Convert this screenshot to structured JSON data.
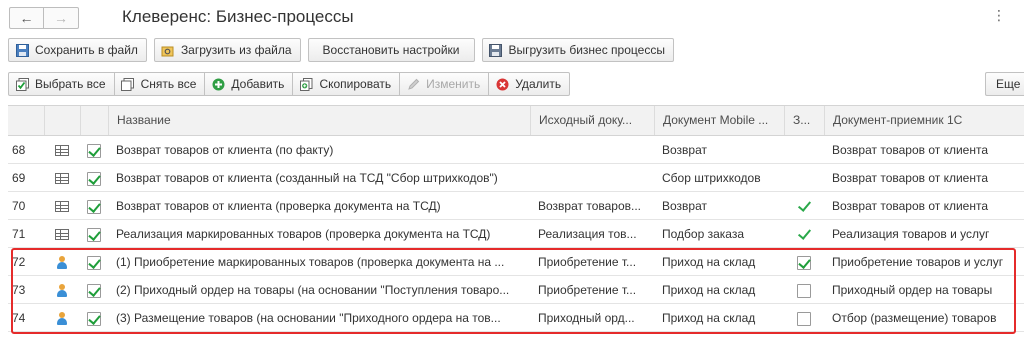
{
  "window": {
    "title": "Клеверенс: Бизнес-процессы"
  },
  "nav": {
    "back": "←",
    "forward": "→",
    "more": "⋮"
  },
  "toolbar1": [
    {
      "label": "Сохранить в файл",
      "icon": "save-icon"
    },
    {
      "label": "Загрузить из файла",
      "icon": "load-icon"
    },
    {
      "label": "Восстановить настройки",
      "icon": ""
    },
    {
      "label": "Выгрузить бизнес процессы",
      "icon": "export-icon"
    }
  ],
  "toolbar2": [
    {
      "label": "Выбрать все",
      "icon": "select-all-icon",
      "disabled": false
    },
    {
      "label": "Снять все",
      "icon": "clear-all-icon",
      "disabled": false
    },
    {
      "label": "Добавить",
      "icon": "add-icon",
      "disabled": false
    },
    {
      "label": "Скопировать",
      "icon": "copy-icon",
      "disabled": false
    },
    {
      "label": "Изменить",
      "icon": "edit-icon",
      "disabled": true
    },
    {
      "label": "Удалить",
      "icon": "delete-icon",
      "disabled": false
    }
  ],
  "more_label": "Еще",
  "columns": {
    "name": "Название",
    "source": "Исходный доку...",
    "mobile": "Документ Mobile ...",
    "z": "З...",
    "dest": "Документ-приемник 1С"
  },
  "rows": [
    {
      "num": "68",
      "type": "table",
      "checked": true,
      "name": "Возврат товаров от клиента (по факту)",
      "source": "",
      "mobile": "Возврат",
      "z": "",
      "dest": "Возврат товаров от клиента"
    },
    {
      "num": "69",
      "type": "table",
      "checked": true,
      "name": "Возврат товаров от клиента (созданный на ТСД \"Сбор штрихкодов\")",
      "source": "",
      "mobile": "Сбор штрихкодов",
      "z": "",
      "dest": "Возврат товаров от клиента"
    },
    {
      "num": "70",
      "type": "table",
      "checked": true,
      "name": "Возврат товаров от клиента (проверка документа на ТСД)",
      "source": "Возврат товаров...",
      "mobile": "Возврат",
      "z": "tick",
      "dest": "Возврат товаров от клиента"
    },
    {
      "num": "71",
      "type": "table",
      "checked": true,
      "name": "Реализация маркированных товаров (проверка документа на ТСД)",
      "source": "Реализация тов...",
      "mobile": "Подбор заказа",
      "z": "tick",
      "dest": "Реализация товаров и услуг"
    },
    {
      "num": "72",
      "type": "person",
      "checked": true,
      "name": "(1) Приобретение маркированных товаров (проверка документа на ...",
      "source": "Приобретение т...",
      "mobile": "Приход на склад",
      "z": "checked",
      "dest": "Приобретение товаров и услуг"
    },
    {
      "num": "73",
      "type": "person",
      "checked": true,
      "name": "(2) Приходный ордер на товары (на основании \"Поступления товаро...",
      "source": "Приобретение т...",
      "mobile": "Приход на склад",
      "z": "unchecked",
      "dest": "Приходный ордер на товары"
    },
    {
      "num": "74",
      "type": "person",
      "checked": true,
      "name": "(3) Размещение товаров (на основании \"Приходного ордера на тов...",
      "source": "Приходный орд...",
      "mobile": "Приход на склад",
      "z": "unchecked",
      "dest": "Отбор (размещение) товаров"
    }
  ],
  "colors": {
    "highlight": "#e52b2b",
    "check": "#1f9e3a"
  }
}
